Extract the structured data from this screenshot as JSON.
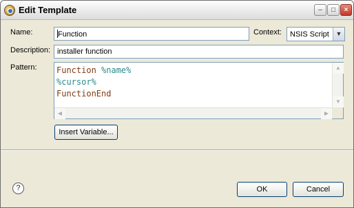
{
  "window": {
    "title": "Edit Template",
    "minimize_glyph": "–",
    "maximize_glyph": "□",
    "close_glyph": "×"
  },
  "form": {
    "name_label": "Name:",
    "name_value": "Function",
    "context_label": "Context:",
    "context_value": "NSIS Script",
    "description_label": "Description:",
    "description_value": "installer function",
    "pattern_label": "Pattern:",
    "pattern_lines": [
      {
        "keyword": "Function",
        "variable": "%name%"
      },
      {
        "keyword": "",
        "variable": "%cursor%"
      },
      {
        "keyword": "FunctionEnd",
        "variable": ""
      }
    ]
  },
  "buttons": {
    "insert_variable": "Insert Variable...",
    "ok": "OK",
    "cancel": "Cancel"
  },
  "help": {
    "glyph": "?"
  },
  "icons": {
    "app": "eclipse-app-icon",
    "help": "help-icon",
    "dropdown": "chevron-down-icon"
  },
  "colors": {
    "keyword": "#7f3b12",
    "variable": "#2b8a8a"
  }
}
